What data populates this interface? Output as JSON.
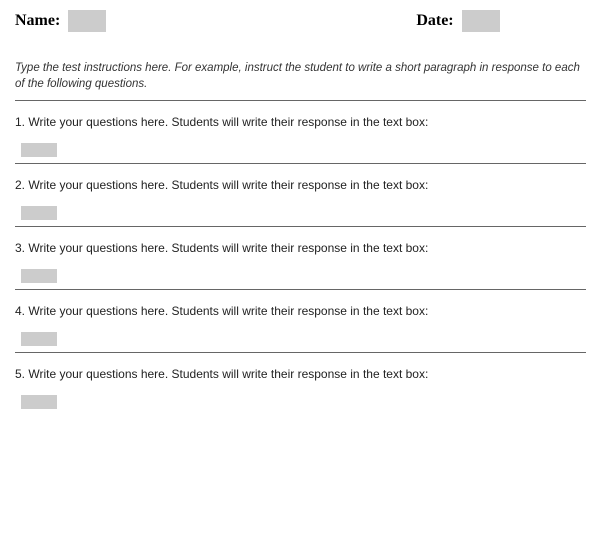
{
  "header": {
    "name_label": "Name:",
    "date_label": "Date:"
  },
  "instructions": "Type the test instructions here.  For example, instruct the student to write a short paragraph in response to each of the following questions.",
  "questions": [
    {
      "prompt": "1. Write your questions here.  Students will write their response in the text box:"
    },
    {
      "prompt": "2.  Write your questions here.  Students will write their response in the text box:"
    },
    {
      "prompt": "3. Write your questions here.  Students will write their response in the text box:"
    },
    {
      "prompt": "4. Write your questions here.  Students will write their response in the text box:"
    },
    {
      "prompt": "5. Write your questions here.  Students will write their response in the text box:"
    }
  ]
}
